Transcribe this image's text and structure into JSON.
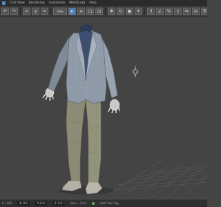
{
  "menubar": {
    "items": [
      "Civil View",
      "Rendering",
      "Customize",
      "MAXScript",
      "Help"
    ]
  },
  "toolbar": {
    "icons": [
      "undo-icon",
      "redo-icon",
      "link-icon",
      "unlink-icon",
      "bind-icon",
      "select-icon",
      "select-by-name-icon",
      "rectangle-select-icon",
      "window-crossing-icon",
      "move-icon",
      "rotate-icon",
      "scale-icon",
      "reference-coord-icon",
      "pivot-icon",
      "snap-icon",
      "angle-snap-icon",
      "percent-snap-icon",
      "spinner-snap-icon",
      "named-selection-icon",
      "mirror-icon",
      "align-icon",
      "layer-icon",
      "graphite-icon",
      "curve-editor-icon",
      "schematic-icon",
      "material-editor-icon",
      "render-setup-icon",
      "render-frame-icon",
      "render-icon"
    ],
    "view_label": "View"
  },
  "statusbar": {
    "left": "0 / 100",
    "coords": [
      "X: 0.0",
      "Y: 0.0",
      "Z: 0.0"
    ],
    "grid": "Grid = 10.0",
    "right": "Add Time Tag"
  },
  "viewport": {
    "background": "#444444",
    "grid_color": "#5a5a5a",
    "jacket_color": "#8f9aa8",
    "trousers_color": "#8a8a72",
    "shirt_color": "#3a4a6a"
  }
}
